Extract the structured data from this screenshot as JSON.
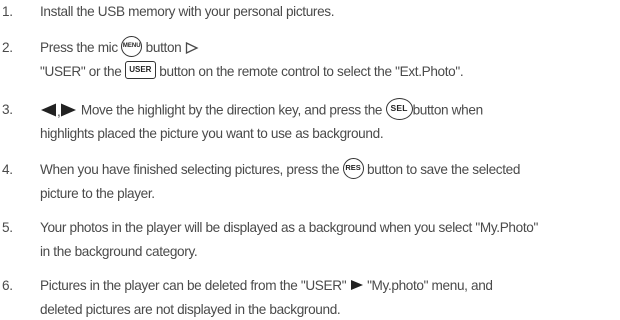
{
  "steps": [
    {
      "number": "1.",
      "text": "Install the USB memory with your personal pictures."
    },
    {
      "number": "2.",
      "line1_a": "Press the mic",
      "line1_b": "button",
      "menu_icon": "MENU",
      "line2_a": "\"USER\" or the",
      "user_icon": "USER",
      "line2_b": "button on the remote control to select the \"Ext.Photo\"."
    },
    {
      "number": "3.",
      "line1_a": "Move the highlight by the direction key, and press the",
      "sel_icon": "SEL",
      "line1_b": "button when",
      "line2": "highlights placed the picture you want to use as background."
    },
    {
      "number": "4.",
      "line1_a": "When you have finished selecting pictures, press the",
      "res_icon": "RES",
      "line1_b": "button to save the selected",
      "line2": "picture to the player."
    },
    {
      "number": "5.",
      "line1": "Your photos in the player will be displayed as a background when you select \"My.Photo\"",
      "line2": "in the background category."
    },
    {
      "number": "6.",
      "line1_a": "Pictures in the player can be deleted from the \"USER\"",
      "line1_b": "\"My.photo\" menu, and",
      "line2": "deleted pictures are not displayed in the background."
    }
  ],
  "icons": {
    "arrow_right": "hollow-right-arrow-icon",
    "left_key": "left-arrow-icon",
    "right_key": "right-arrow-icon",
    "menu_arrow": "right-arrow-icon"
  },
  "colors": {
    "text": "#4a4a4a",
    "icon_border": "#333333"
  }
}
